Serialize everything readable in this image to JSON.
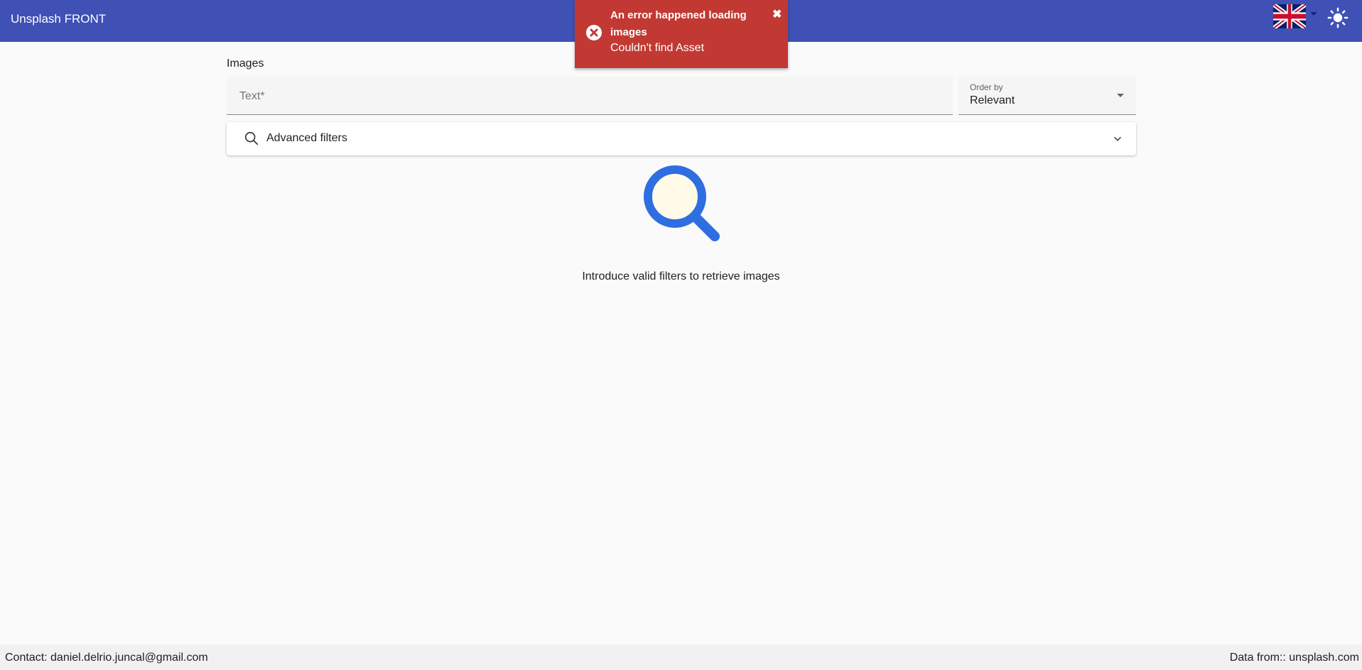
{
  "app": {
    "title": "Unsplash FRONT",
    "primary_color": "#3f51b5"
  },
  "header": {
    "language_icon": "uk-flag-icon",
    "theme_icon": "sun-icon"
  },
  "toast": {
    "title": "An error happened loading images",
    "message": "Couldn't find Asset",
    "close_label": "✖",
    "icon": "error-circle-icon",
    "color": "#c23934"
  },
  "search": {
    "section_label": "Images",
    "text_placeholder": "Text*",
    "text_value": "",
    "order_label": "Order by",
    "order_value": "Relevant"
  },
  "filters": {
    "label": "Advanced filters",
    "icon": "search-icon",
    "expand_icon": "chevron-down-icon"
  },
  "empty_state": {
    "icon": "magnifier-icon",
    "message": "Introduce valid filters to retrieve images"
  },
  "footer": {
    "contact": "Contact: daniel.delrio.juncal@gmail.com",
    "source": "Data from:: unsplash.com"
  }
}
